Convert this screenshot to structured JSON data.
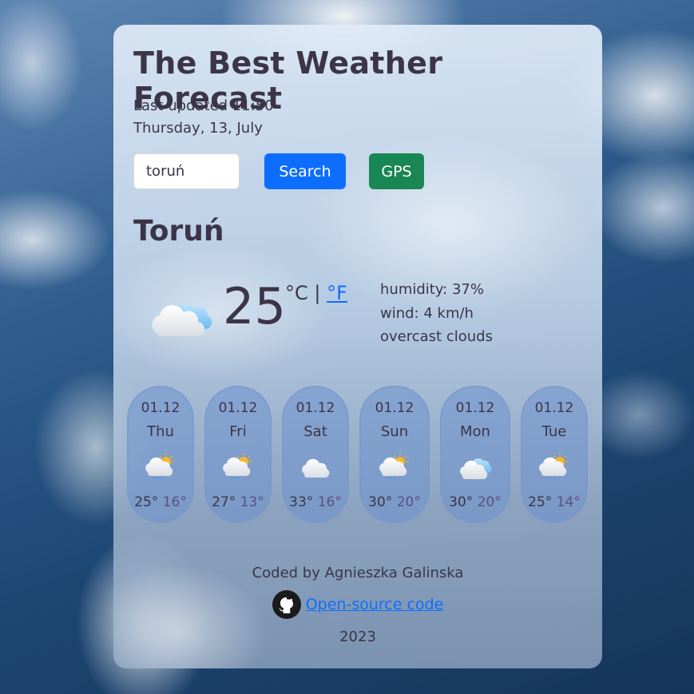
{
  "header": {
    "title": "The Best Weather Forecast",
    "last_updated": "Last updated 11:50",
    "date": "Thursday, 13, July"
  },
  "search": {
    "value": "toruń",
    "placeholder": "",
    "search_label": "Search",
    "gps_label": "GPS"
  },
  "current": {
    "city": "Toruń",
    "icon": "overcast-clouds-icon",
    "temperature": "25",
    "unit_celsius": "°C",
    "separator": "|",
    "unit_fahrenheit": "°F",
    "humidity": "humidity: 37%",
    "wind": "wind: 4 km/h",
    "description": "overcast clouds"
  },
  "forecast": [
    {
      "date": "01.12",
      "day": "Thu",
      "icon": "sun-cloud-rain-icon",
      "high": "25°",
      "low": "16°"
    },
    {
      "date": "01.12",
      "day": "Fri",
      "icon": "sun-cloud-rain-icon",
      "high": "27°",
      "low": "13°"
    },
    {
      "date": "01.12",
      "day": "Sat",
      "icon": "cloud-icon",
      "high": "33°",
      "low": "16°"
    },
    {
      "date": "01.12",
      "day": "Sun",
      "icon": "sun-cloud-rain-icon",
      "high": "30°",
      "low": "20°"
    },
    {
      "date": "01.12",
      "day": "Mon",
      "icon": "overcast-clouds-icon",
      "high": "30°",
      "low": "20°"
    },
    {
      "date": "01.12",
      "day": "Tue",
      "icon": "sun-cloud-rain-icon",
      "high": "25°",
      "low": "14°"
    }
  ],
  "footer": {
    "coded_by": "Coded by Agnieszka Galinska",
    "github_icon": "github-icon",
    "source_link": "Open-source code",
    "year": "2023"
  },
  "colors": {
    "primary": "#0d6efd",
    "success": "#198754",
    "text": "#3b3547",
    "low_temp": "#5b4f85"
  }
}
